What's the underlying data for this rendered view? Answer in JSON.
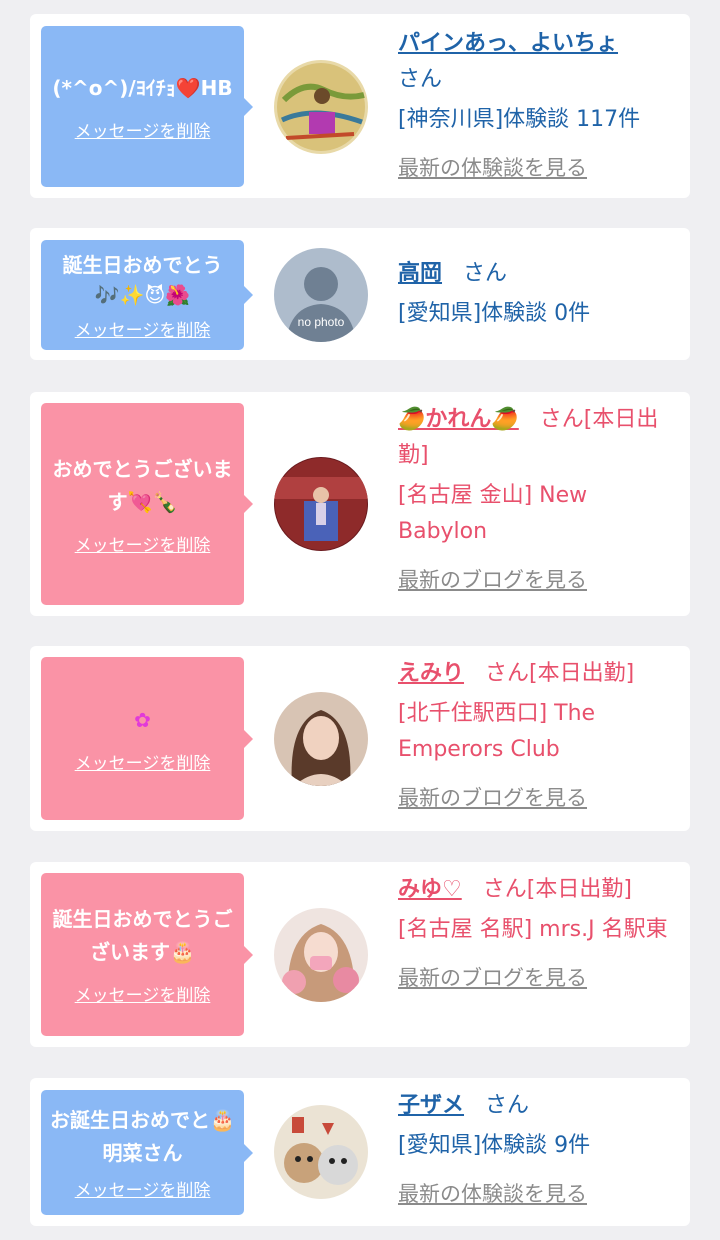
{
  "delete_label": "メッセージを削除",
  "cards": [
    {
      "message": "(*^o^)/ﾖｲﾁｮ❤️HB",
      "name": "パインあっ、よいちょ",
      "suffix": "さん",
      "region": "[神奈川県]体験談 117件",
      "latest_link": "最新の体験談を見る",
      "theme": "blue"
    },
    {
      "message": "誕生日おめでとう🎶✨😈🌺",
      "name": "高岡",
      "suffix": "さん",
      "avatar_text": "no photo",
      "region": "[愛知県]体験談 0件",
      "latest_link": "",
      "theme": "blue"
    },
    {
      "message": "おめでとうございます💘🍾",
      "name": "🥭かれん🥭",
      "suffix": "さん[本日出勤]",
      "region": "[名古屋 金山] New Babylon",
      "latest_link": "最新のブログを見る",
      "theme": "pink"
    },
    {
      "message": "✿",
      "name": "えみり",
      "suffix": "さん[本日出勤]",
      "region": "[北千住駅西口] The Emperors Club",
      "latest_link": "最新のブログを見る",
      "theme": "pink"
    },
    {
      "message": "誕生日おめでとうございます🎂",
      "name": "みゆ♡",
      "suffix": "さん[本日出勤]",
      "region": "[名古屋 名駅] mrs.J 名駅東",
      "latest_link": "最新のブログを見る",
      "theme": "pink"
    },
    {
      "message": "お誕生日おめでと🎂明菜さん",
      "name": "子ザメ",
      "suffix": "さん",
      "region": "[愛知県]体験談 9件",
      "latest_link": "最新の体験談を見る",
      "theme": "blue"
    }
  ],
  "colors": {
    "background": "#efeff2",
    "bubble_blue": "#8ab8f5",
    "bubble_pink": "#fa93a6",
    "text_blue": "#1f63a8",
    "text_pink": "#e8506c",
    "link_gray": "#8b8b8b"
  },
  "icons": [
    "avatar-photo",
    "no-photo-avatar",
    "delete-message-link"
  ]
}
